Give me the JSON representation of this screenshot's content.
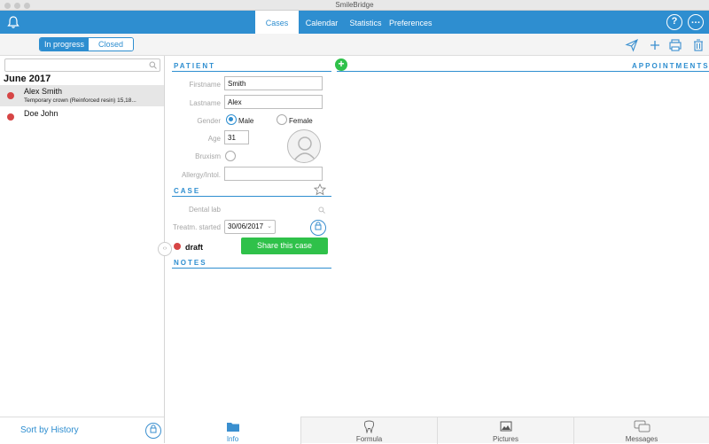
{
  "window": {
    "title": "SmileBridge"
  },
  "toolbar": {
    "tabs": [
      {
        "label": "Cases"
      },
      {
        "label": "Calendar"
      },
      {
        "label": "Statistics"
      },
      {
        "label": "Preferences"
      }
    ],
    "help_glyph": "?",
    "more_glyph": "…"
  },
  "filter": {
    "in_progress": "In progress",
    "closed": "Closed"
  },
  "sidebar": {
    "month": "June 2017",
    "cases": [
      {
        "name": "Alex Smith",
        "detail": "Temporary crown (Reinforced resin) 15,18..."
      },
      {
        "name": "Doe John",
        "detail": ""
      }
    ],
    "sort_label": "Sort by History"
  },
  "patient": {
    "section": "PATIENT",
    "firstname_label": "Firstname",
    "firstname": "Smith",
    "lastname_label": "Lastname",
    "lastname": "Alex",
    "gender_label": "Gender",
    "gender_male": "Male",
    "gender_female": "Female",
    "age_label": "Age",
    "age": "31",
    "bruxism_label": "Bruxism",
    "allergy_label": "Allergy/Intol.",
    "allergy": ""
  },
  "case": {
    "section": "CASE",
    "dental_lab_label": "Dental lab",
    "treatment_label": "Treatm. started",
    "treatment_date": "30/06/2017",
    "status": "draft",
    "share_label": "Share this case"
  },
  "notes": {
    "section": "NOTES"
  },
  "appointments": {
    "section": "APPOINTMENTS"
  },
  "bottom_tabs": [
    {
      "label": "Info"
    },
    {
      "label": "Formula"
    },
    {
      "label": "Pictures"
    },
    {
      "label": "Messages"
    }
  ],
  "colors": {
    "accent": "#2e8ed0",
    "status_red": "#d64545",
    "share_green": "#2fc14a"
  }
}
